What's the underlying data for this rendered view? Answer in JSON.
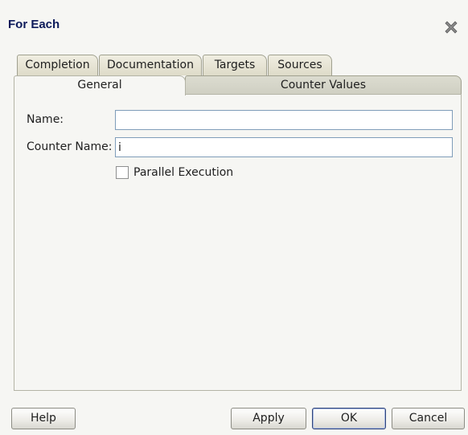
{
  "dialog": {
    "title": "For Each"
  },
  "tabs": {
    "back_row": [
      {
        "label": "Completion"
      },
      {
        "label": "Documentation"
      },
      {
        "label": "Targets"
      },
      {
        "label": "Sources"
      }
    ],
    "front_row": [
      {
        "label": "General",
        "selected": true
      },
      {
        "label": "Counter Values",
        "selected": false
      }
    ]
  },
  "general": {
    "name_label": "Name:",
    "name_value": "",
    "counter_name_label": "Counter Name:",
    "counter_name_value": "i",
    "parallel_label": "Parallel Execution",
    "parallel_checked": false
  },
  "buttons": {
    "help": "Help",
    "apply": "Apply",
    "ok": "OK",
    "cancel": "Cancel"
  }
}
